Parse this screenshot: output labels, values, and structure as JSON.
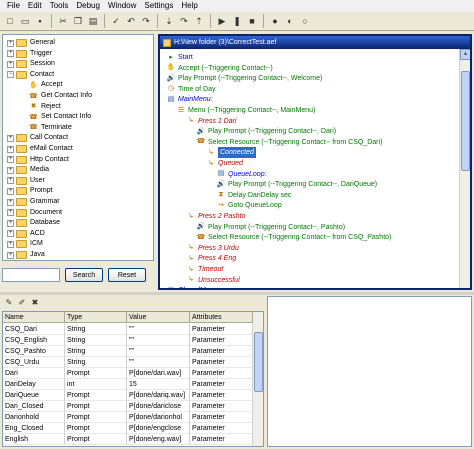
{
  "menu": [
    "File",
    "Edit",
    "Tools",
    "Debug",
    "Window",
    "Settings",
    "Help"
  ],
  "toolbar": {
    "buttons": [
      "new-icon",
      "open-icon",
      "save-icon",
      "cut-icon",
      "copy-icon",
      "paste-icon",
      "validate-icon",
      "undo-icon",
      "redo-icon",
      "step-into-icon",
      "step-over-icon",
      "step-out-icon",
      "run-icon",
      "pause-icon",
      "stop-icon",
      "breakpoint-icon",
      "toggle-breakpoint-icon",
      "clear-breakpoints-icon"
    ]
  },
  "palette": {
    "categories": [
      {
        "label": "General",
        "expanded": false
      },
      {
        "label": "Trigger",
        "expanded": false
      },
      {
        "label": "Session",
        "expanded": false
      },
      {
        "label": "Contact",
        "expanded": true,
        "children": [
          "Accept",
          "Get Contact Info",
          "Reject",
          "Set Contact Info",
          "Terminate"
        ]
      },
      {
        "label": "Call Contact",
        "expanded": false
      },
      {
        "label": "eMail Contact",
        "expanded": false
      },
      {
        "label": "Http Contact",
        "expanded": false
      },
      {
        "label": "Media",
        "expanded": false
      },
      {
        "label": "User",
        "expanded": false
      },
      {
        "label": "Prompt",
        "expanded": false
      },
      {
        "label": "Grammar",
        "expanded": false
      },
      {
        "label": "Document",
        "expanded": false
      },
      {
        "label": "Database",
        "expanded": false
      },
      {
        "label": "ACD",
        "expanded": false
      },
      {
        "label": "ICM",
        "expanded": false
      },
      {
        "label": "Java",
        "expanded": false
      }
    ],
    "search_value": "",
    "search_button": "Search",
    "reset_button": "Reset"
  },
  "script": {
    "title": "H:\\New folder (3)\\CorrectTest.aef",
    "steps": [
      {
        "label": "Start",
        "color": "blue",
        "icon": "start-icon",
        "depth": 0
      },
      {
        "label": "Accept (--Triggering Contact--)",
        "color": "green",
        "icon": "accept-icon",
        "depth": 0
      },
      {
        "label": "Play Prompt (--Triggering Contact--, Welcome)",
        "color": "green",
        "icon": "play-prompt-icon",
        "depth": 0
      },
      {
        "label": "Time of Day",
        "color": "green",
        "icon": "clock-icon",
        "depth": 0
      },
      {
        "label": "MainMenu:",
        "color": "blue",
        "icon": "label-icon",
        "depth": 0,
        "italic": true
      },
      {
        "label": "Menu (--Triggering Contact--, MainMenu)",
        "color": "green",
        "icon": "menu-icon",
        "depth": 1
      },
      {
        "label": "Press 1 Dari",
        "color": "red",
        "icon": "branch-icon",
        "depth": 2,
        "italic": true
      },
      {
        "label": "Play Prompt (--Triggering Contact--, Dari)",
        "color": "green",
        "icon": "play-prompt-icon",
        "depth": 3
      },
      {
        "label": "Select Resource (--Triggering Contact-- from CSQ_Dari)",
        "color": "green",
        "icon": "select-resource-icon",
        "depth": 3
      },
      {
        "label": "Connected",
        "color": "red",
        "icon": "branch-icon",
        "depth": 4,
        "italic": true,
        "selected": true
      },
      {
        "label": "Queued",
        "color": "red",
        "icon": "branch-icon",
        "depth": 4,
        "italic": true
      },
      {
        "label": "QueueLoop:",
        "color": "blue",
        "icon": "label-icon",
        "depth": 5,
        "italic": true
      },
      {
        "label": "Play Prompt (--Triggering Contact--, DariQueue)",
        "color": "green",
        "icon": "play-prompt-icon",
        "depth": 5
      },
      {
        "label": "Delay DariDelay sec",
        "color": "green",
        "icon": "delay-icon",
        "depth": 5
      },
      {
        "label": "Goto QueueLoop",
        "color": "green",
        "icon": "goto-icon",
        "depth": 5,
        "italic_suffix": true
      },
      {
        "label": "Press 2 Pashto",
        "color": "red",
        "icon": "branch-icon",
        "depth": 2,
        "italic": true
      },
      {
        "label": "Play Prompt (--Triggering Contact--, Pashto)",
        "color": "green",
        "icon": "play-prompt-icon",
        "depth": 3
      },
      {
        "label": "Select Resource (--Triggering Contact-- from CSQ_Pashto)",
        "color": "green",
        "icon": "select-resource-icon",
        "depth": 3
      },
      {
        "label": "Press 3 Urdu",
        "color": "red",
        "icon": "branch-icon",
        "depth": 2,
        "italic": true
      },
      {
        "label": "Press 4 Eng",
        "color": "red",
        "icon": "branch-icon",
        "depth": 2,
        "italic": true
      },
      {
        "label": "Timeout",
        "color": "red",
        "icon": "branch-icon",
        "depth": 2,
        "italic": true
      },
      {
        "label": "Unsuccessful",
        "color": "red",
        "icon": "branch-icon",
        "depth": 2,
        "italic": true
      },
      {
        "label": "ClosedMenu:",
        "color": "blue",
        "icon": "label-icon",
        "depth": 0,
        "italic": true
      }
    ]
  },
  "variables": {
    "toolbar": [
      "add-variable-icon",
      "edit-variable-icon",
      "delete-variable-icon"
    ],
    "columns": [
      "Name",
      "Type",
      "Value",
      "Attributes"
    ],
    "rows": [
      [
        "CSQ_Dari",
        "String",
        "\"\"",
        "Parameter"
      ],
      [
        "CSQ_English",
        "String",
        "\"\"",
        "Parameter"
      ],
      [
        "CSQ_Pashto",
        "String",
        "\"\"",
        "Parameter"
      ],
      [
        "CSQ_Urdu",
        "String",
        "\"\"",
        "Parameter"
      ],
      [
        "Dari",
        "Prompt",
        "P[done/dari.wav]",
        "Parameter"
      ],
      [
        "DariDelay",
        "int",
        "15",
        "Parameter"
      ],
      [
        "DariQueue",
        "Prompt",
        "P[done/dariq.wav]",
        "Parameter"
      ],
      [
        "Dari_Closed",
        "Prompt",
        "P[done/dariclose",
        "Parameter"
      ],
      [
        "Darionhold",
        "Prompt",
        "P[done/darionhol",
        "Parameter"
      ],
      [
        "Eng_Closed",
        "Prompt",
        "P[done/engclose",
        "Parameter"
      ],
      [
        "English",
        "Prompt",
        "P[done/eng.wav]",
        "Parameter"
      ]
    ]
  }
}
